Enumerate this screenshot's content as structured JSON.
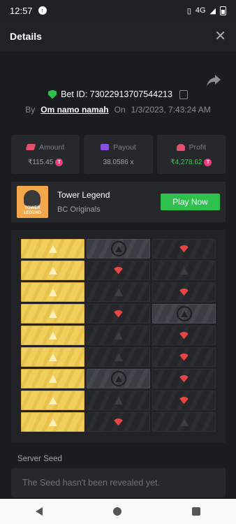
{
  "status_bar": {
    "time": "12:57",
    "network": "4G"
  },
  "header": {
    "title": "Details"
  },
  "bet": {
    "id_label": "Bet ID: 73022913707544213",
    "by_label": "By",
    "user": "Om namo namah",
    "on_label": "On",
    "datetime": "1/3/2023, 7:43:24 AM"
  },
  "stats": {
    "amount": {
      "label": "Amount",
      "value": "₹115.45"
    },
    "payout": {
      "label": "Payout",
      "value": "38.0586 x"
    },
    "profit": {
      "label": "Profit",
      "value": "₹4,278.62"
    }
  },
  "game": {
    "name": "Tower Legend",
    "provider": "BC Originals",
    "thumb_label": "TOWER LEGEND",
    "play_label": "Play Now"
  },
  "board": {
    "rows": [
      [
        "gold",
        "grey-ring",
        "melon"
      ],
      [
        "gold",
        "melon",
        "dark"
      ],
      [
        "gold",
        "dark",
        "melon"
      ],
      [
        "gold",
        "melon",
        "grey-ring"
      ],
      [
        "gold",
        "dark",
        "melon"
      ],
      [
        "gold",
        "dark",
        "melon"
      ],
      [
        "gold",
        "grey-ring",
        "melon"
      ],
      [
        "gold",
        "dark",
        "melon"
      ],
      [
        "gold",
        "melon",
        "dark"
      ]
    ]
  },
  "seed": {
    "label": "Server Seed",
    "value": "The Seed hasn't been revealed yet."
  },
  "colors": {
    "accent_green": "#2ec14e",
    "gold": "#f0cf5c",
    "profit_green": "#3bc85a"
  }
}
